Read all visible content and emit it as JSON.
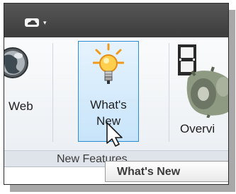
{
  "toolbar": {
    "qat_icon": "cloud-icon",
    "qat_dropdown_glyph": "▾"
  },
  "ribbon": {
    "web": {
      "label": "Web",
      "icon": "globe-icon"
    },
    "whats_new": {
      "label_line1": "What's",
      "label_line2": "New",
      "icon": "lightbulb-icon",
      "state": "hover"
    },
    "overview": {
      "label": "Overvi",
      "icon": "film-gear-icon"
    },
    "panel_title": "New Features"
  },
  "tooltip": {
    "text": "What's New"
  },
  "cursor": {
    "icon": "arrow-cursor-icon"
  },
  "colors": {
    "title_strip": "#454545",
    "hover_border": "#2a8dd4",
    "hover_fill": "#d3eafb",
    "ribbon_bg": "#f3f5f8",
    "drop_shadow": "#a8a8a8"
  }
}
